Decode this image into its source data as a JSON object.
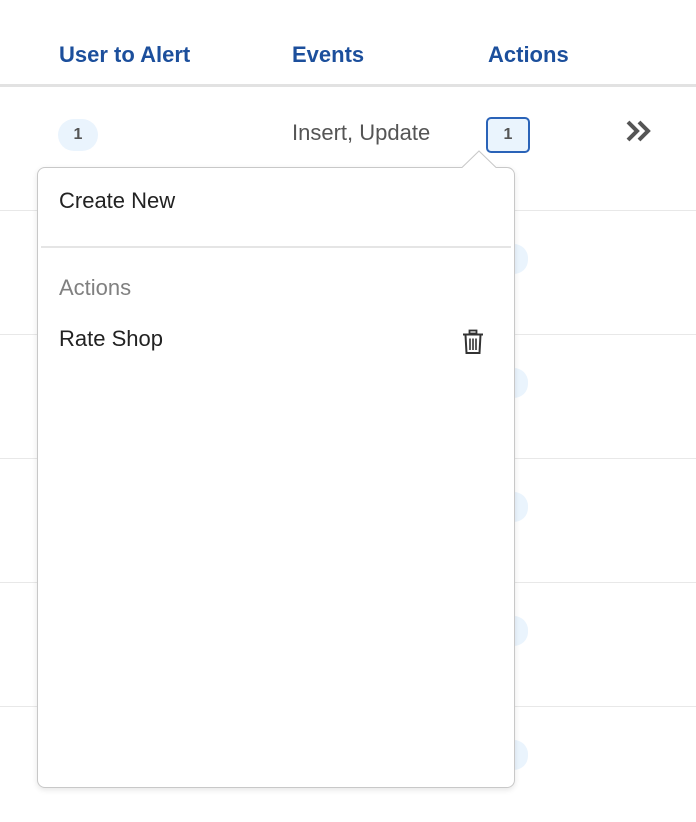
{
  "table": {
    "headers": {
      "user_to_alert": "User to Alert",
      "events": "Events",
      "actions": "Actions"
    },
    "rows": [
      {
        "user_count": "1",
        "events": "Insert, Update",
        "action_count": "1"
      }
    ]
  },
  "popover": {
    "create_new_label": "Create New",
    "section_label": "Actions",
    "items": [
      {
        "label": "Rate Shop"
      }
    ]
  },
  "colors": {
    "header_text": "#1c4f9c",
    "pill_background": "#eaf4fd",
    "active_border": "#2a63b8"
  },
  "icons": {
    "expand": "double-chevron-right-icon",
    "delete": "trash-icon"
  }
}
